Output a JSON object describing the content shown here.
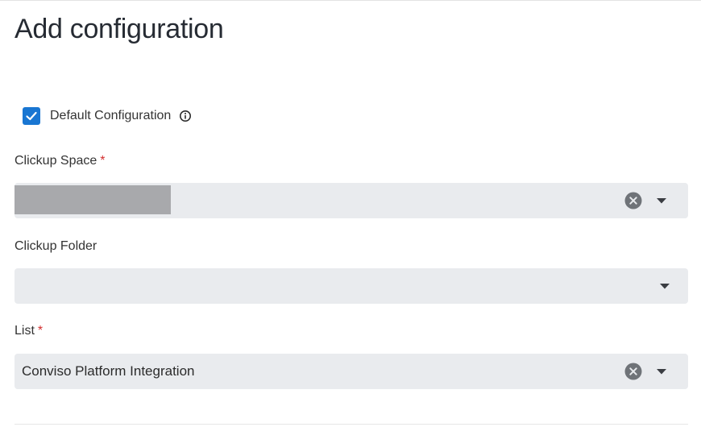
{
  "dialog": {
    "title": "Add configuration"
  },
  "default_config": {
    "label": "Default Configuration",
    "checked": true,
    "info_icon": "info-icon"
  },
  "fields": {
    "space": {
      "label": "Clickup Space",
      "required_mark": "*",
      "value": ""
    },
    "folder": {
      "label": "Clickup Folder",
      "value": ""
    },
    "list": {
      "label": "List",
      "required_mark": "*",
      "value": "Conviso Platform Integration"
    }
  },
  "icons": {
    "clear": "clear-icon",
    "dropdown": "chevron-down-icon",
    "check": "checkmark-icon"
  },
  "colors": {
    "accent": "#1976d2",
    "required": "#d32f2f",
    "field_bg": "#e9ebee"
  }
}
